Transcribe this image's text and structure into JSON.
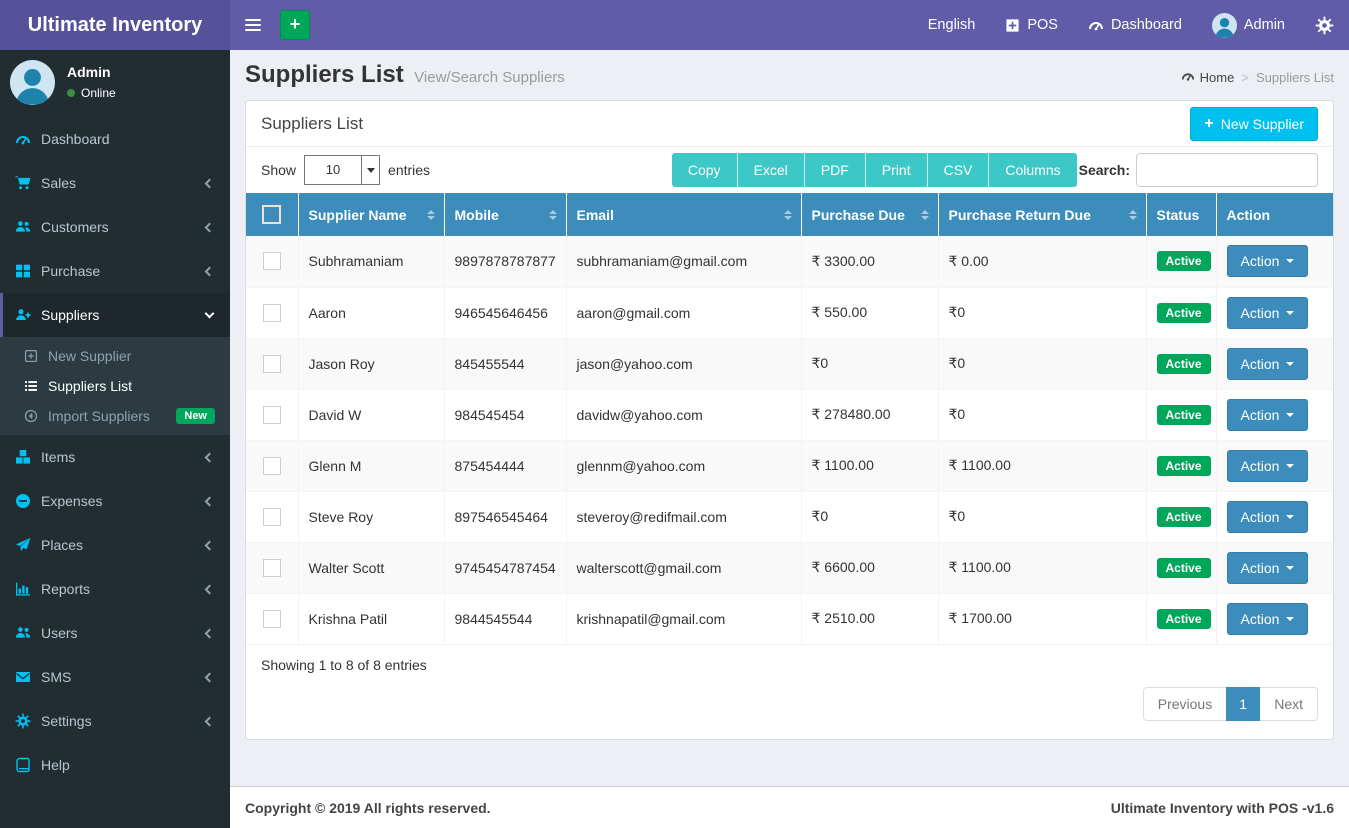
{
  "navbar": {
    "brand": "Ultimate Inventory",
    "language": "English",
    "pos": "POS",
    "dashboard": "Dashboard",
    "user": "Admin"
  },
  "sidebar": {
    "user_name": "Admin",
    "user_status": "Online",
    "menu": [
      {
        "label": "Dashboard",
        "icon": "gauge-icon"
      },
      {
        "label": "Sales",
        "icon": "cart-icon",
        "chevron": "left"
      },
      {
        "label": "Customers",
        "icon": "users-icon",
        "chevron": "left"
      },
      {
        "label": "Purchase",
        "icon": "grid-icon",
        "chevron": "left"
      },
      {
        "label": "Suppliers",
        "icon": "user-plus-icon",
        "chevron": "down",
        "active": true,
        "submenu": [
          {
            "label": "New Supplier",
            "icon": "plus-square-outline-icon"
          },
          {
            "label": "Suppliers List",
            "icon": "list-icon",
            "active": true
          },
          {
            "label": "Import Suppliers",
            "icon": "arrow-circle-left-icon",
            "badge": "New"
          }
        ]
      },
      {
        "label": "Items",
        "icon": "cubes-icon",
        "chevron": "left"
      },
      {
        "label": "Expenses",
        "icon": "minus-circle-icon",
        "chevron": "left"
      },
      {
        "label": "Places",
        "icon": "paper-plane-icon",
        "chevron": "left"
      },
      {
        "label": "Reports",
        "icon": "bar-chart-icon",
        "chevron": "left"
      },
      {
        "label": "Users",
        "icon": "users-icon",
        "chevron": "left"
      },
      {
        "label": "SMS",
        "icon": "envelope-icon",
        "chevron": "left"
      },
      {
        "label": "Settings",
        "icon": "gear-icon",
        "chevron": "left"
      },
      {
        "label": "Help",
        "icon": "book-icon"
      }
    ]
  },
  "page": {
    "title": "Suppliers List",
    "subtitle": "View/Search Suppliers",
    "breadcrumb_home": "Home",
    "breadcrumb_current": "Suppliers List"
  },
  "panel": {
    "title": "Suppliers List",
    "new_button": "New Supplier",
    "show_label": "Show",
    "page_length": "10",
    "entries_label": "entries",
    "export_buttons": [
      "Copy",
      "Excel",
      "PDF",
      "Print",
      "CSV",
      "Columns"
    ],
    "search_label": "Search:",
    "search_value": "",
    "table": {
      "columns": [
        {
          "label": "Supplier Name",
          "sortable": true
        },
        {
          "label": "Mobile",
          "sortable": true
        },
        {
          "label": "Email",
          "sortable": true
        },
        {
          "label": "Purchase Due",
          "sortable": true
        },
        {
          "label": "Purchase Return Due",
          "sortable": true
        },
        {
          "label": "Status",
          "sortable": false
        },
        {
          "label": "Action",
          "sortable": false
        }
      ],
      "rows": [
        {
          "name": "Subhramaniam",
          "mobile": "9897878787877",
          "email": "subhramaniam@gmail.com",
          "purchase_due": "₹ 3300.00",
          "purchase_return_due": "₹ 0.00",
          "status": "Active",
          "action": "Action"
        },
        {
          "name": "Aaron",
          "mobile": "946545646456",
          "email": "aaron@gmail.com",
          "purchase_due": "₹ 550.00",
          "purchase_return_due": "₹0",
          "status": "Active",
          "action": "Action"
        },
        {
          "name": "Jason Roy",
          "mobile": "845455544",
          "email": "jason@yahoo.com",
          "purchase_due": "₹0",
          "purchase_return_due": "₹0",
          "status": "Active",
          "action": "Action"
        },
        {
          "name": "David W",
          "mobile": "984545454",
          "email": "davidw@yahoo.com",
          "purchase_due": "₹ 278480.00",
          "purchase_return_due": "₹0",
          "status": "Active",
          "action": "Action"
        },
        {
          "name": "Glenn M",
          "mobile": "875454444",
          "email": "glennm@yahoo.com",
          "purchase_due": "₹ 1100.00",
          "purchase_return_due": "₹ 1100.00",
          "status": "Active",
          "action": "Action"
        },
        {
          "name": "Steve Roy",
          "mobile": "897546545464",
          "email": "steveroy@redifmail.com",
          "purchase_due": "₹0",
          "purchase_return_due": "₹0",
          "status": "Active",
          "action": "Action"
        },
        {
          "name": "Walter Scott",
          "mobile": "9745454787454",
          "email": "walterscott@gmail.com",
          "purchase_due": "₹ 6600.00",
          "purchase_return_due": "₹ 1100.00",
          "status": "Active",
          "action": "Action"
        },
        {
          "name": "Krishna Patil",
          "mobile": "9844545544",
          "email": "krishnapatil@gmail.com",
          "purchase_due": "₹ 2510.00",
          "purchase_return_due": "₹ 1700.00",
          "status": "Active",
          "action": "Action"
        }
      ]
    },
    "showing_text": "Showing 1 to 8 of 8 entries",
    "pagination": {
      "previous": "Previous",
      "current": "1",
      "next": "Next"
    }
  },
  "footer": {
    "copyright": "Copyright © 2019 All rights reserved.",
    "version": "Ultimate Inventory with POS -v1.6"
  },
  "colors": {
    "navbar_purple": "#605ca8",
    "logo_purple": "#555299",
    "sidebar_dark": "#222d32",
    "accent_green": "#00a65a",
    "table_header_blue": "#3c8dbc",
    "info_cyan": "#00c0ef",
    "export_teal": "#3dc8c8",
    "sidebar_icon_cyan": "#00c0ef"
  }
}
